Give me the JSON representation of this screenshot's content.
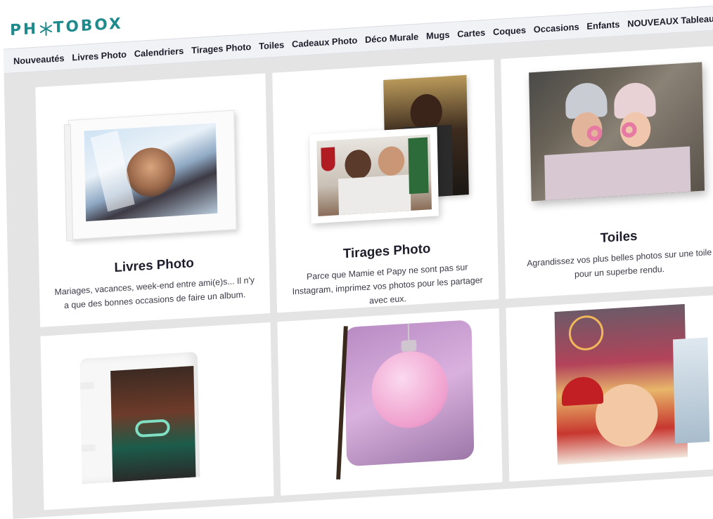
{
  "brand": {
    "logo_left": "PH",
    "logo_right": "TOBOX"
  },
  "nav": {
    "items": [
      "Nouveautés",
      "Livres Photo",
      "Calendriers",
      "Tirages Photo",
      "Toiles",
      "Cadeaux Photo",
      "Déco Murale",
      "Mugs",
      "Cartes",
      "Coques",
      "Occasions",
      "Enfants",
      "NOUVEAUX Tableaux Photo Ac"
    ]
  },
  "cards": [
    {
      "title": "Livres Photo",
      "desc": "Mariages, vacances, week-end entre ami(e)s... Il n'y a que des bonnes occasions de faire un album."
    },
    {
      "title": "Tirages Photo",
      "desc": "Parce que Mamie et Papy ne sont pas sur Instagram, imprimez vos photos pour les partager avec eux."
    },
    {
      "title": "Toiles",
      "desc": "Agrandissez vos plus belles photos sur une toile pour un superbe rendu."
    }
  ],
  "colors": {
    "brand": "#1f8a8c",
    "nav_bg": "#f1f2f6",
    "grid_bg": "#e4e4e4"
  }
}
